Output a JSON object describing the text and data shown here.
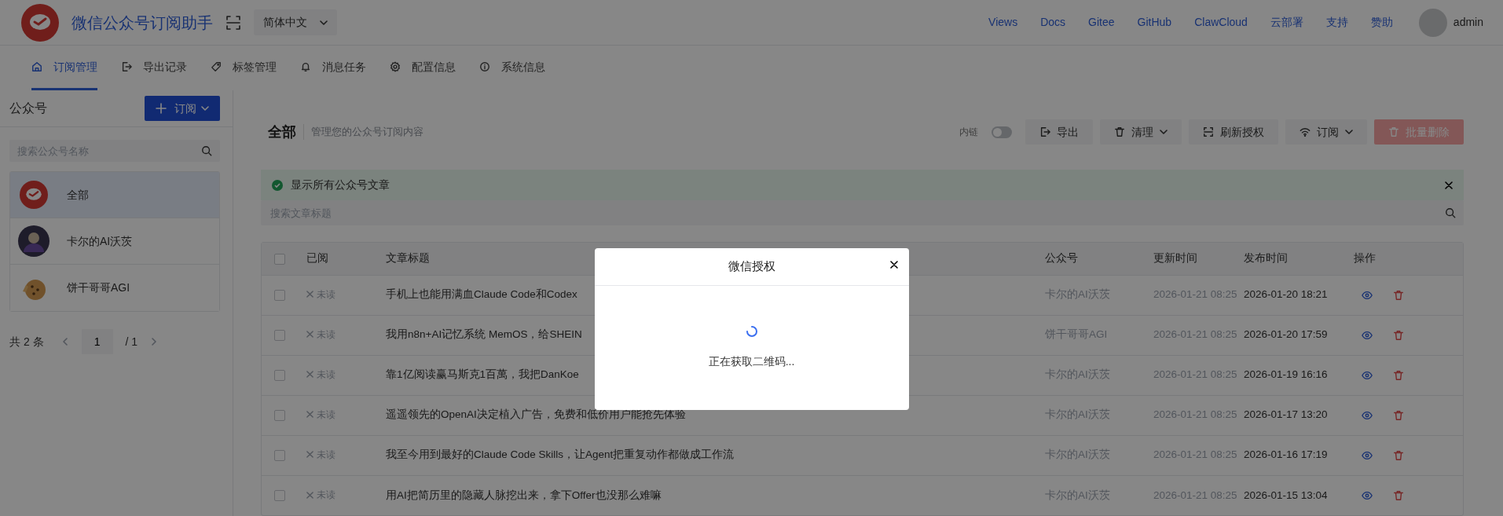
{
  "app": {
    "title": "微信公众号订阅助手",
    "language": "简体中文"
  },
  "top_links": [
    "Views",
    "Docs",
    "Gitee",
    "GitHub",
    "ClawCloud",
    "云部署",
    "支持",
    "赞助"
  ],
  "user": {
    "name": "admin"
  },
  "tabs": [
    {
      "label": "订阅管理",
      "kind": "home",
      "selected": true
    },
    {
      "label": "导出记录",
      "kind": "export",
      "selected": false
    },
    {
      "label": "标签管理",
      "kind": "tag",
      "selected": false
    },
    {
      "label": "消息任务",
      "kind": "bell",
      "selected": false
    },
    {
      "label": "配置信息",
      "kind": "gear",
      "selected": false
    },
    {
      "label": "系统信息",
      "kind": "info",
      "selected": false
    }
  ],
  "sidebar": {
    "title": "公众号",
    "subscribe_button": "订阅",
    "search": {
      "placeholder": "搜索公众号名称"
    },
    "accounts": [
      {
        "name": "全部",
        "kind": "all",
        "selected": true
      },
      {
        "name": "卡尔的AI沃茨",
        "kind": "person",
        "selected": false
      },
      {
        "name": "饼干哥哥AGI",
        "kind": "cookie",
        "selected": false
      }
    ],
    "pagination": {
      "total": "共 2 条",
      "page": "1",
      "pages": "/ 1"
    }
  },
  "main": {
    "title": "全部",
    "subtitle": "管理您的公众号订阅内容",
    "inline_link": {
      "label": "内链",
      "on": false
    },
    "buttons": [
      {
        "label": "导出",
        "kind": "export",
        "dropdown": false,
        "disabled": false
      },
      {
        "label": "清理",
        "kind": "clean",
        "dropdown": true,
        "disabled": false
      },
      {
        "label": "刷新授权",
        "kind": "refresh",
        "dropdown": false,
        "disabled": false
      },
      {
        "label": "订阅",
        "kind": "subscribe",
        "dropdown": true,
        "disabled": false
      },
      {
        "label": "批量删除",
        "kind": "delete",
        "dropdown": false,
        "disabled": true
      }
    ],
    "alert": "显示所有公众号文章",
    "search": {
      "placeholder": "搜索文章标题"
    },
    "table": {
      "select_all": {
        "checked": false
      },
      "columns": [
        "已阅",
        "文章标题",
        "公众号",
        "更新时间",
        "发布时间",
        "操作"
      ],
      "rows": [
        {
          "checked": false,
          "read": false,
          "read_label": "未读",
          "title": "手机上也能用满血Claude Code和Codex",
          "account": "卡尔的AI沃茨",
          "updated": "2026-01-21 08:25",
          "published": "2026-01-20 18:21"
        },
        {
          "checked": false,
          "read": false,
          "read_label": "未读",
          "title": "我用n8n+AI记忆系统 MemOS，给SHEIN",
          "account": "饼干哥哥AGI",
          "updated": "2026-01-21 08:25",
          "published": "2026-01-20 17:59"
        },
        {
          "checked": false,
          "read": false,
          "read_label": "未读",
          "title": "靠1亿阅读赢马斯克1百萬，我把DanKoe",
          "account": "卡尔的AI沃茨",
          "updated": "2026-01-21 08:25",
          "published": "2026-01-19 16:16"
        },
        {
          "checked": false,
          "read": false,
          "read_label": "未读",
          "title": "遥遥领先的OpenAI决定植入广告，免费和低价用户能抢先体验",
          "account": "卡尔的AI沃茨",
          "updated": "2026-01-21 08:25",
          "published": "2026-01-17 13:20"
        },
        {
          "checked": false,
          "read": false,
          "read_label": "未读",
          "title": "我至今用到最好的Claude Code Skills，让Agent把重复动作都做成工作流",
          "account": "卡尔的AI沃茨",
          "updated": "2026-01-21 08:25",
          "published": "2026-01-16 17:19"
        },
        {
          "checked": false,
          "read": false,
          "read_label": "未读",
          "title": "用AI把简历里的隐藏人脉挖出来，拿下Offer也没那么难嘛",
          "account": "卡尔的AI沃茨",
          "updated": "2026-01-21 08:25",
          "published": "2026-01-15 13:04"
        }
      ]
    }
  },
  "modal": {
    "title": "微信授权",
    "message": "正在获取二维码..."
  }
}
